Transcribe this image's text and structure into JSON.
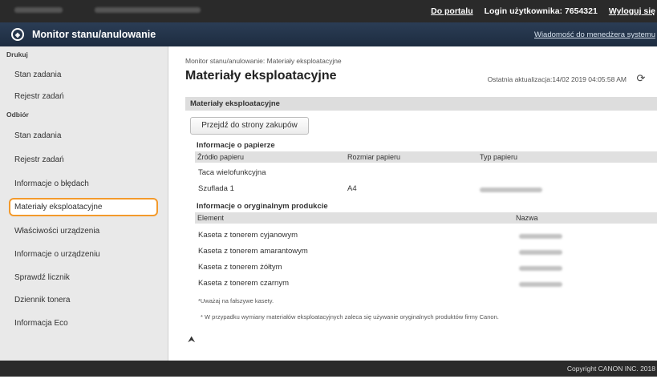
{
  "topbar": {
    "portal_link": "Do portalu",
    "login_label": "Login użytkownika:",
    "login_value": "7654321",
    "logout_link": "Wyloguj się"
  },
  "header": {
    "app_title": "Monitor stanu/anulowanie",
    "message_link": "Wiadomość do menedżera systemu"
  },
  "sidebar": {
    "print_section": "Drukuj",
    "print_items": [
      "Stan zadania",
      "Rejestr zadań"
    ],
    "receive_section": "Odbiór",
    "receive_items": [
      "Stan zadania",
      "Rejestr zadań",
      "Informacje o błędach",
      "Materiały eksploatacyjne",
      "Właściwości urządzenia",
      "Informacje o urządzeniu",
      "Sprawdź licznik",
      "Dziennik tonera",
      "Informacja Eco"
    ]
  },
  "main": {
    "breadcrumb": "Monitor stanu/anulowanie: Materiały eksploatacyjne",
    "page_title": "Materiały eksploatacyjne",
    "last_update": "Ostatnia aktualizacja:14/02 2019 04:05:58 AM",
    "panel_title": "Materiały eksploatacyjne",
    "buy_button": "Przejdź do strony zakupów",
    "paper_section": "Informacje o papierze",
    "paper_headers": [
      "Źródło papieru",
      "Rozmiar papieru",
      "Typ papieru"
    ],
    "paper_rows": [
      {
        "source": "Taca wielofunkcyjna",
        "size": "",
        "type": ""
      },
      {
        "source": "Szuflada 1",
        "size": "A4",
        "type": ""
      }
    ],
    "genuine_section": "Informacje o oryginalnym produkcie",
    "genuine_headers": [
      "Element",
      "Nazwa"
    ],
    "genuine_rows": [
      "Kaseta z tonerem cyjanowym",
      "Kaseta z tonerem amarantowym",
      "Kaseta z tonerem żółtym",
      "Kaseta z tonerem czarnym"
    ],
    "note_1": "*Uważaj na fałszywe kasety.",
    "note_2": "* W przypadku wymiany materiałów eksploatacyjnych zaleca się używanie oryginalnych produktów firmy Canon.",
    "back_to_top": "⮝"
  },
  "footer": {
    "copyright": "Copyright CANON INC. 2018"
  },
  "colors": {
    "accent_selected_border": "#f39a2c",
    "header_bg": "#22344b",
    "topbar_bg": "#2a2a2a"
  },
  "icons": {
    "logo": "logo-icon",
    "refresh": "refresh-icon",
    "back_to_top": "back-to-top-icon"
  }
}
